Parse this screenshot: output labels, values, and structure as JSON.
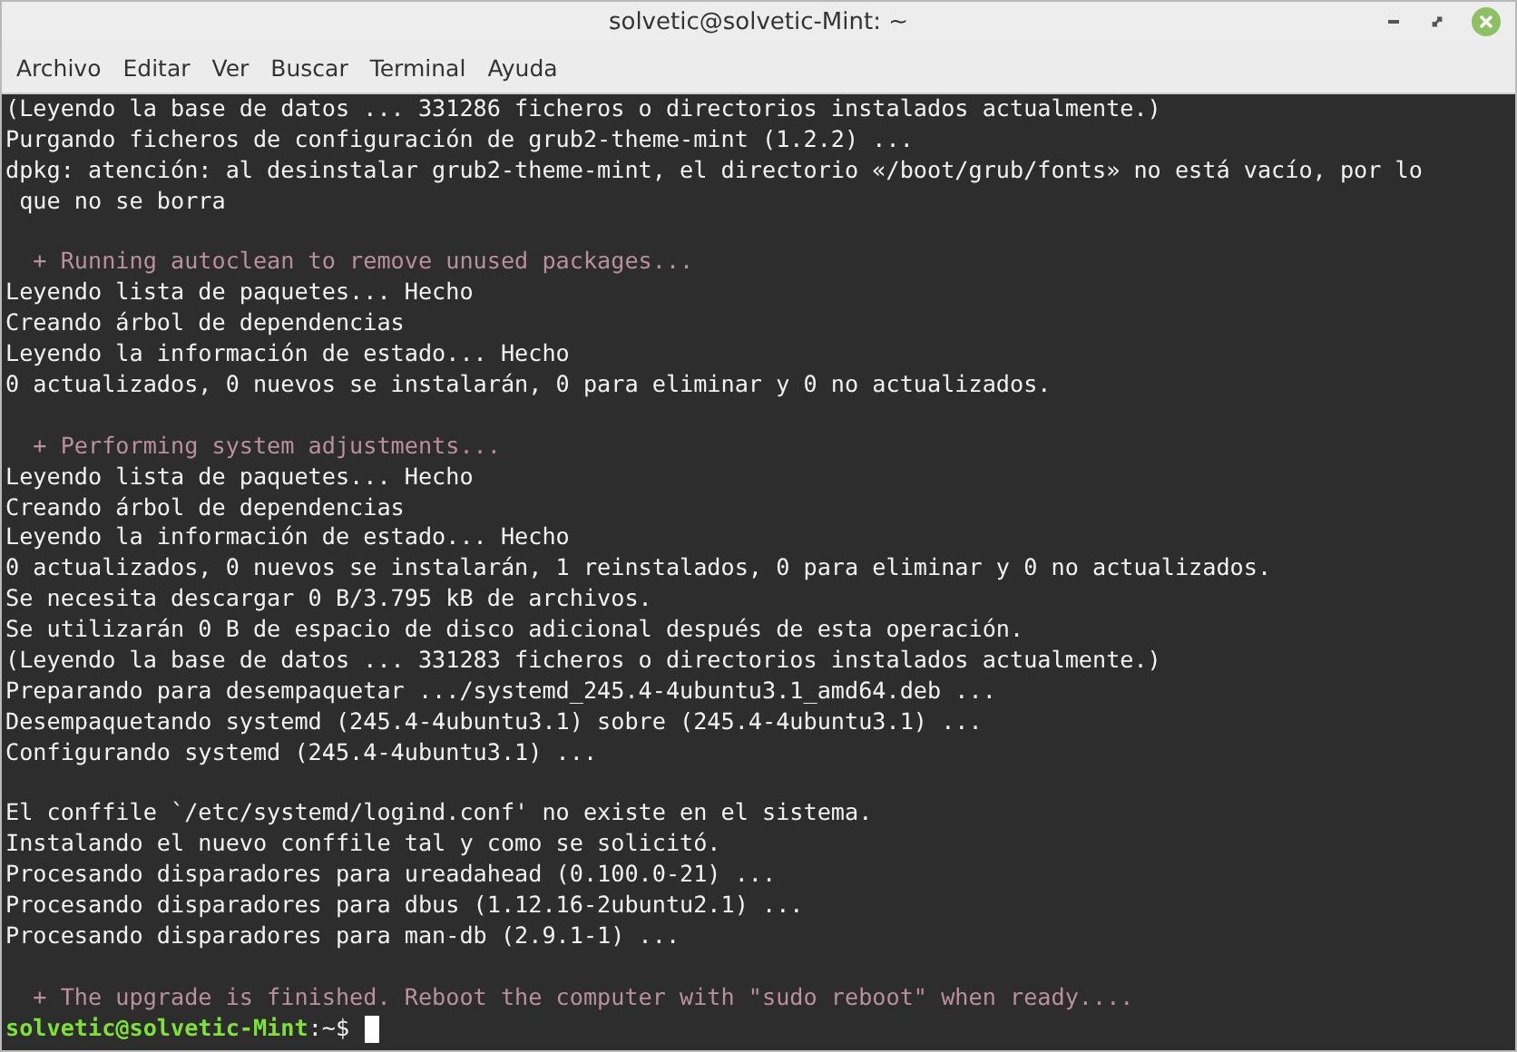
{
  "window": {
    "title": "solvetic@solvetic-Mint: ~"
  },
  "menu": [
    "Archivo",
    "Editar",
    "Ver",
    "Buscar",
    "Terminal",
    "Ayuda"
  ],
  "lines": [
    {
      "kind": "output",
      "text": "(Leyendo la base de datos ... 331286 ficheros o directorios instalados actualmente.)"
    },
    {
      "kind": "output",
      "text": "Purgando ficheros de configuración de grub2-theme-mint (1.2.2) ..."
    },
    {
      "kind": "output",
      "text": "dpkg: atención: al desinstalar grub2-theme-mint, el directorio «/boot/grub/fonts» no está vacío, por lo"
    },
    {
      "kind": "output",
      "text": " que no se borra"
    },
    {
      "kind": "blank"
    },
    {
      "kind": "notice",
      "text": "  + Running autoclean to remove unused packages..."
    },
    {
      "kind": "output",
      "text": "Leyendo lista de paquetes... Hecho"
    },
    {
      "kind": "output",
      "text": "Creando árbol de dependencias"
    },
    {
      "kind": "output",
      "text": "Leyendo la información de estado... Hecho"
    },
    {
      "kind": "output",
      "text": "0 actualizados, 0 nuevos se instalarán, 0 para eliminar y 0 no actualizados."
    },
    {
      "kind": "blank"
    },
    {
      "kind": "notice",
      "text": "  + Performing system adjustments..."
    },
    {
      "kind": "output",
      "text": "Leyendo lista de paquetes... Hecho"
    },
    {
      "kind": "output",
      "text": "Creando árbol de dependencias"
    },
    {
      "kind": "output",
      "text": "Leyendo la información de estado... Hecho"
    },
    {
      "kind": "output",
      "text": "0 actualizados, 0 nuevos se instalarán, 1 reinstalados, 0 para eliminar y 0 no actualizados."
    },
    {
      "kind": "output",
      "text": "Se necesita descargar 0 B/3.795 kB de archivos."
    },
    {
      "kind": "output",
      "text": "Se utilizarán 0 B de espacio de disco adicional después de esta operación."
    },
    {
      "kind": "output",
      "text": "(Leyendo la base de datos ... 331283 ficheros o directorios instalados actualmente.)"
    },
    {
      "kind": "output",
      "text": "Preparando para desempaquetar .../systemd_245.4-4ubuntu3.1_amd64.deb ..."
    },
    {
      "kind": "output",
      "text": "Desempaquetando systemd (245.4-4ubuntu3.1) sobre (245.4-4ubuntu3.1) ..."
    },
    {
      "kind": "output",
      "text": "Configurando systemd (245.4-4ubuntu3.1) ..."
    },
    {
      "kind": "blank"
    },
    {
      "kind": "output",
      "text": "El conffile `/etc/systemd/logind.conf' no existe en el sistema."
    },
    {
      "kind": "output",
      "text": "Instalando el nuevo conffile tal y como se solicitó."
    },
    {
      "kind": "output",
      "text": "Procesando disparadores para ureadahead (0.100.0-21) ..."
    },
    {
      "kind": "output",
      "text": "Procesando disparadores para dbus (1.12.16-2ubuntu2.1) ..."
    },
    {
      "kind": "output",
      "text": "Procesando disparadores para man-db (2.9.1-1) ..."
    },
    {
      "kind": "blank"
    },
    {
      "kind": "notice",
      "text": "  + The upgrade is finished. Reboot the computer with \"sudo reboot\" when ready...."
    }
  ],
  "prompt": {
    "user_host": "solvetic@solvetic-Mint",
    "path": ":~$"
  }
}
